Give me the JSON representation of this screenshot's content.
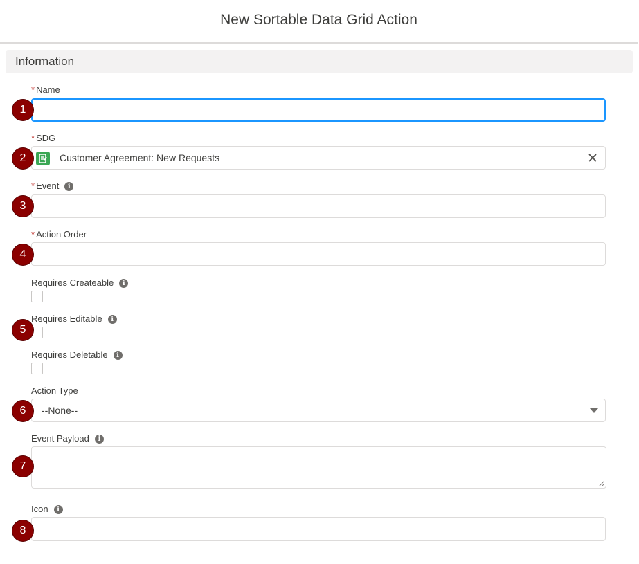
{
  "header": {
    "title": "New Sortable Data Grid Action"
  },
  "section": {
    "title": "Information"
  },
  "required_marker": "*",
  "info_glyph": "i",
  "markers": [
    "1",
    "2",
    "3",
    "4",
    "5",
    "6",
    "7",
    "8"
  ],
  "fields": {
    "name": {
      "label": "Name",
      "required": true,
      "value": ""
    },
    "sdg": {
      "label": "SDG",
      "required": true,
      "value": "Customer Agreement: New Requests",
      "icon": "record-icon"
    },
    "event": {
      "label": "Event",
      "required": true,
      "value": ""
    },
    "action_order": {
      "label": "Action Order",
      "required": true,
      "value": ""
    },
    "requires_createable": {
      "label": "Requires Createable",
      "checked": false
    },
    "requires_editable": {
      "label": "Requires Editable",
      "checked": false
    },
    "requires_deletable": {
      "label": "Requires Deletable",
      "checked": false
    },
    "action_type": {
      "label": "Action Type",
      "value": "--None--"
    },
    "event_payload": {
      "label": "Event Payload",
      "value": ""
    },
    "icon": {
      "label": "Icon",
      "value": ""
    }
  },
  "colors": {
    "marker": "#8b0000",
    "required": "#c23934",
    "focus": "#1b96ff",
    "sdg_icon": "#3ba755"
  }
}
